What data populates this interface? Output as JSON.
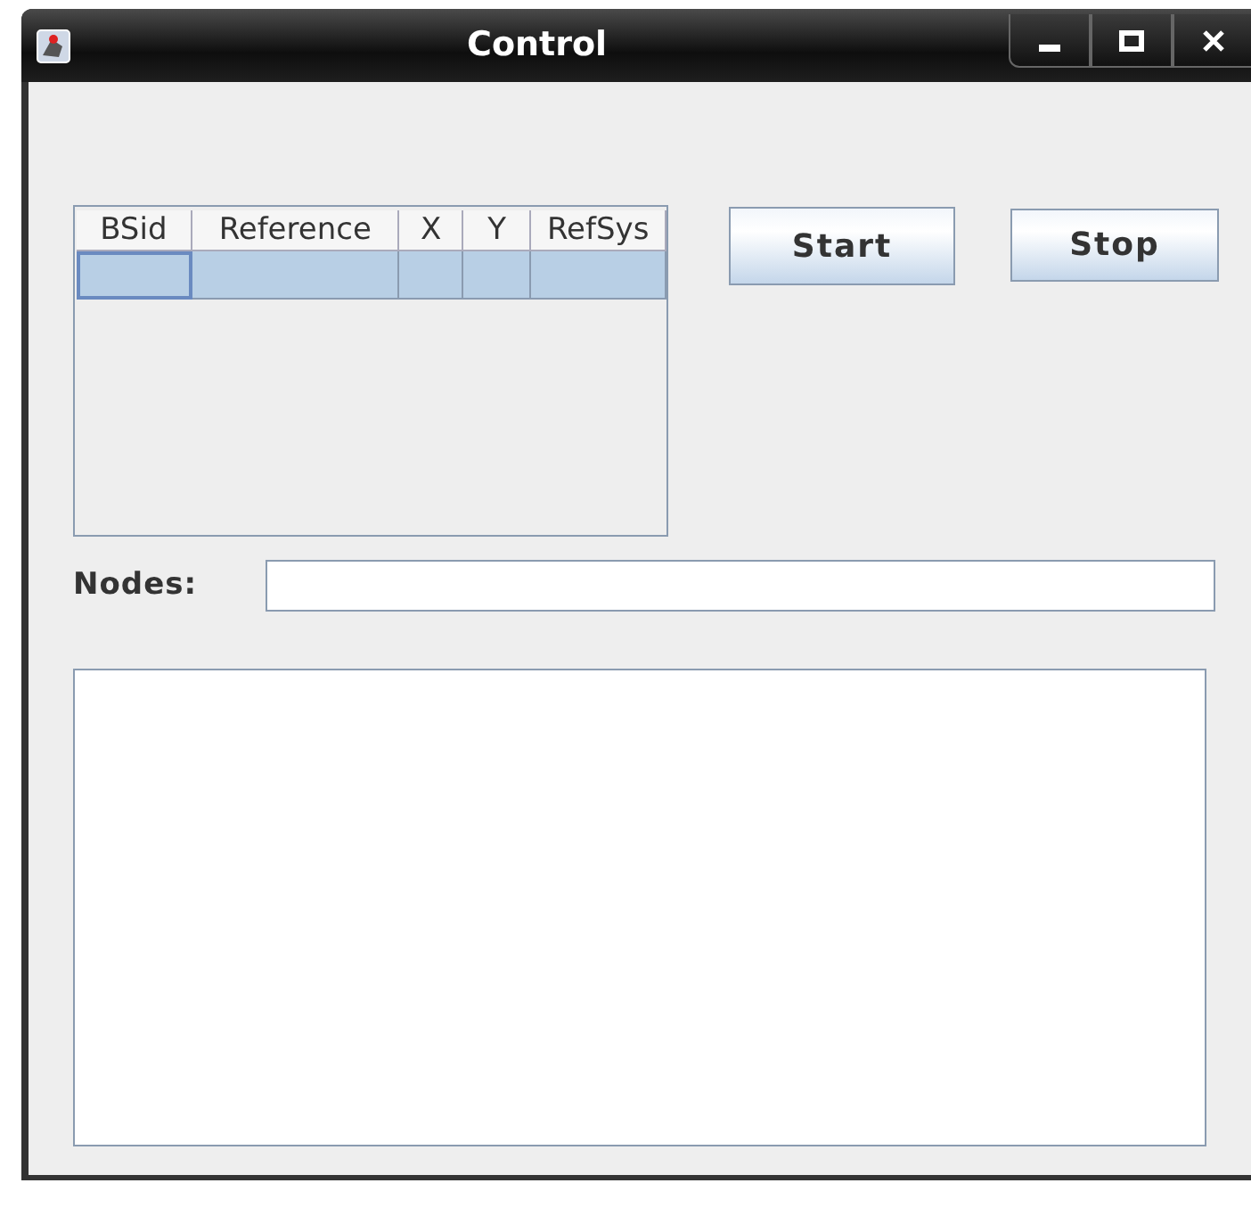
{
  "window": {
    "title": "Control",
    "controls": [
      {
        "kind": "minimize"
      },
      {
        "kind": "maximize"
      },
      {
        "kind": "close"
      }
    ]
  },
  "table": {
    "columns": [
      "BSid",
      "Reference",
      "X",
      "Y",
      "RefSys"
    ],
    "rows": [
      {
        "selected": true
      }
    ]
  },
  "buttons": [
    "Start",
    "Stop"
  ],
  "nodes": {
    "label": "Nodes:"
  }
}
